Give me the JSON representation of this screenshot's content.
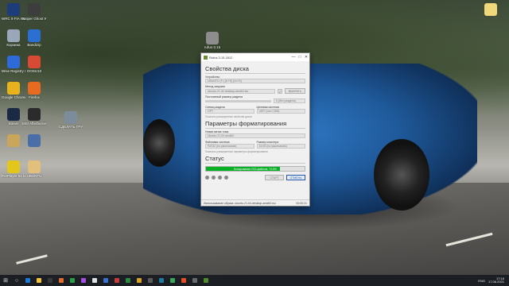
{
  "desktop": {
    "icons": [
      {
        "label": "WRC 9 FIA World Rally...",
        "color": "#1d3c7a"
      },
      {
        "label": "Sniper Ghost Warrior Co...",
        "color": "#3d3d3d"
      },
      {
        "label": "Корзина",
        "color": "#9aa7b8"
      },
      {
        "label": "Bandizip",
        "color": "#2b6fd3"
      },
      {
        "label": "Wise Registry Cleaner",
        "color": "#2f6bd8"
      },
      {
        "label": "OOSU10",
        "color": "#d94a35"
      },
      {
        "label": "Google Chrome",
        "color": "#e8b21c"
      },
      {
        "label": "Firefox",
        "color": "#e66a1f"
      },
      {
        "label": "Steam",
        "color": "#1a2a44"
      },
      {
        "label": "MSI Afterburner",
        "color": "#2b2b2b"
      },
      {
        "label": "",
        "color": "#c9a65a"
      },
      {
        "label": "",
        "color": "#4a6ea8"
      },
      {
        "label": "PotPlayer 64 bit",
        "color": "#e2c61b"
      },
      {
        "label": "UBUNTU",
        "color": "#e0c07a"
      }
    ],
    "floating_icon": {
      "label": "rufus-3.15",
      "color": "#8d8d8d"
    },
    "floating_icon2": {
      "label": "СДЕЛАТЬ ГРУ",
      "color": "#7d8c9a"
    },
    "right_icon": {
      "label": "",
      "color": "#f0d77a"
    }
  },
  "window": {
    "title": "Rufus 3.15.1812",
    "min": "—",
    "max": "□",
    "close": "✕",
    "section_disk": "Свойства диска",
    "device_label": "Устройство",
    "device_value": "UBUNTU (F:) [8 Гб] [16 ГБ]",
    "boot_label": "Метод загрузки",
    "boot_value": "ubuntu-21.04-desktop-amd64.iso",
    "select_btn": "ВЫБРАТЬ",
    "persist_label": "Постоянный размер раздела",
    "persist_value": "0 (без раздела)",
    "partition_label": "Схема раздела",
    "partition_value": "GPT",
    "target_label": "Целевая система",
    "target_value": "UEFI (non CSM)",
    "adv_disk": "Показать расширенные свойства диска",
    "section_format": "Параметры форматирования",
    "volume_label": "Новая метка тома",
    "volume_value": "Ubuntu 21.04 amd64",
    "fs_label": "Файловая система",
    "fs_value": "FAT32 (по умолчанию)",
    "cluster_label": "Размер кластера",
    "cluster_value": "16 Кб (по умолчанию)",
    "adv_format": "Показать расширенные параметры форматирования",
    "section_status": "Статус",
    "progress_text": "Копирование ISO-файлов: 74.6%",
    "progress_pct": 74.6,
    "start_btn": "СТАРТ",
    "cancel_btn": "ОТМЕНА",
    "status_line": "Использование образа: ubuntu-21.04-desktop-amd64.iso",
    "status_time": "00:00:21"
  },
  "taskbar": {
    "start": "⊞",
    "search": "○",
    "apps": [
      "#1c77d6",
      "#f2c43d",
      "#3a3a3a",
      "#e26a2e",
      "#2a9d46",
      "#a44ee0",
      "#e0e0e0",
      "#3d6fcf",
      "#c63a3a",
      "#2c8a3f",
      "#d9a227",
      "#5b5b5b",
      "#1f7a9b",
      "#3aa65a",
      "#e34c26",
      "#6a6a6a",
      "#4c8a2e"
    ],
    "lang": "ENG",
    "time": "17:16",
    "date": "17.06.2021"
  }
}
